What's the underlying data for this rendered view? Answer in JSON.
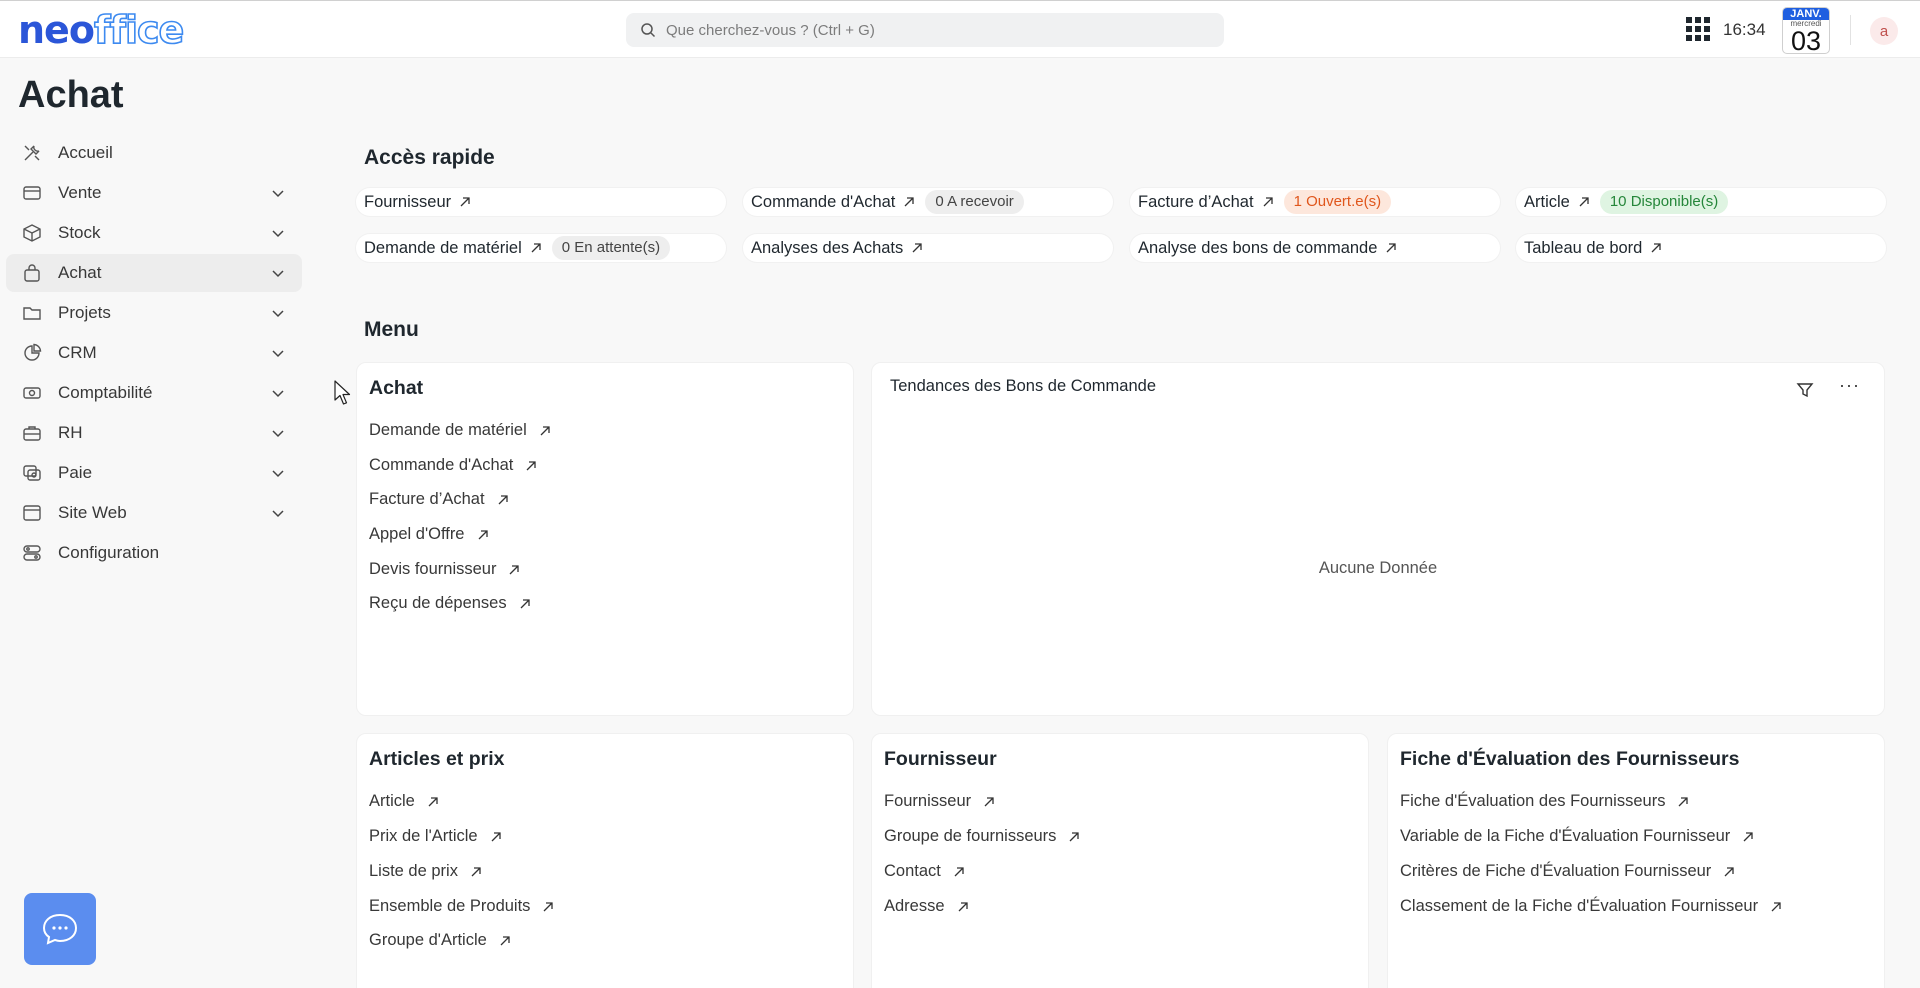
{
  "navbar": {
    "logo_part1": "neo",
    "logo_part2": "ffice",
    "search_placeholder": "Que cherchez-vous ? (Ctrl + G)",
    "time": "16:34",
    "calendar_month": "JANV.",
    "calendar_weekday": "mercredi",
    "calendar_day": "03",
    "avatar_letter": "a"
  },
  "page": {
    "title": "Achat"
  },
  "sidebar": {
    "items": [
      {
        "label": "Accueil",
        "icon": "tools-icon",
        "expandable": false
      },
      {
        "label": "Vente",
        "icon": "card-icon",
        "expandable": true
      },
      {
        "label": "Stock",
        "icon": "box-icon",
        "expandable": true
      },
      {
        "label": "Achat",
        "icon": "bag-icon",
        "expandable": true,
        "active": true
      },
      {
        "label": "Projets",
        "icon": "folder-icon",
        "expandable": true
      },
      {
        "label": "CRM",
        "icon": "pie-icon",
        "expandable": true
      },
      {
        "label": "Comptabilité",
        "icon": "money-icon",
        "expandable": true
      },
      {
        "label": "RH",
        "icon": "briefcase-icon",
        "expandable": true
      },
      {
        "label": "Paie",
        "icon": "coins-icon",
        "expandable": true
      },
      {
        "label": "Site Web",
        "icon": "browser-icon",
        "expandable": true
      },
      {
        "label": "Configuration",
        "icon": "settings-icon",
        "expandable": false
      }
    ]
  },
  "quick_access": {
    "title": "Accès rapide",
    "items": [
      {
        "label": "Fournisseur",
        "badge": ""
      },
      {
        "label": "Commande d'Achat",
        "badge": "0 A recevoir",
        "badge_color": "grey"
      },
      {
        "label": "Facture d’Achat",
        "badge": "1 Ouvert.e(s)",
        "badge_color": "orange"
      },
      {
        "label": "Article",
        "badge": "10 Disponible(s)",
        "badge_color": "green"
      },
      {
        "label": "Demande de matériel",
        "badge": "0 En attente(s)",
        "badge_color": "grey"
      },
      {
        "label": "Analyses des Achats",
        "badge": ""
      },
      {
        "label": "Analyse des bons de commande",
        "badge": ""
      },
      {
        "label": "Tableau de bord",
        "badge": ""
      }
    ]
  },
  "menu": {
    "title": "Menu",
    "achat_card": {
      "title": "Achat",
      "links": [
        "Demande de matériel",
        "Commande d'Achat",
        "Facture d’Achat",
        "Appel d'Offre",
        "Devis fournisseur",
        "Reçu de dépenses"
      ]
    },
    "chart_card": {
      "title": "Tendances des Bons de Commande",
      "empty_text": "Aucune Donnée",
      "more_label": "···"
    },
    "articles_card": {
      "title": "Articles et prix",
      "links": [
        "Article",
        "Prix de l'Article",
        "Liste de prix",
        "Ensemble de Produits",
        "Groupe d'Article"
      ]
    },
    "fournisseur_card": {
      "title": "Fournisseur",
      "links": [
        "Fournisseur",
        "Groupe de fournisseurs",
        "Contact",
        "Adresse"
      ]
    },
    "evaluation_card": {
      "title": "Fiche d'Évaluation des Fournisseurs",
      "links": [
        "Fiche d'Évaluation des Fournisseurs",
        "Variable de la Fiche d'Évaluation Fournisseur",
        "Critères de Fiche d'Évaluation Fournisseur",
        "Classement de la Fiche d'Évaluation Fournisseur"
      ]
    }
  }
}
